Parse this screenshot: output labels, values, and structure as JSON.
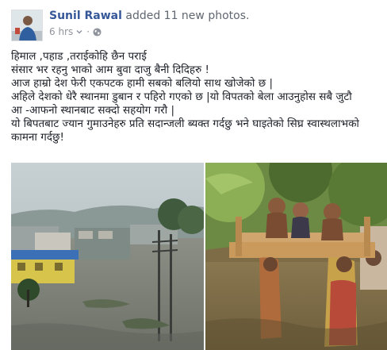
{
  "post": {
    "author_name": "Sunil Rawal",
    "action_text": "added 11 new photos.",
    "timestamp": "6 hrs",
    "separator": "·",
    "audience_icon": "globe-icon",
    "menu_icon": "chevron-down-icon",
    "body_lines": [
      "हिमाल ,पहाड ,तराईकोहि छैन पराई",
      "संसार भर रहनु भाको आम बुवा दाजु बैनी दिदिहरु !",
      "आज हाम्रो देश फेरी एकपटक हामी सबको बलियो साथ खोजेको छ |",
      "अहिले देशको धेरै स्थानमा डुबान र पहिरो गएको छ |यो विपतको बेला आउनुहोस सबै जुटौ",
      "आ -आफनो स्थानबाट सक्दो सहयोग गरौ |",
      "यो बिपतबाट ज्यान गुमाउनेहरु प्रति सदान्जली ब्यक्त गर्दछु भने घाइतेको सिघ्र स्वास्थलाभको",
      "कामना गर्दछु!"
    ],
    "photos": [
      {
        "name": "flooded-town-photo"
      },
      {
        "name": "children-carried-in-floodwater-photo"
      }
    ]
  },
  "colors": {
    "author_link": "#365899",
    "secondary_text": "#90949c",
    "body_text": "#1d2129"
  }
}
